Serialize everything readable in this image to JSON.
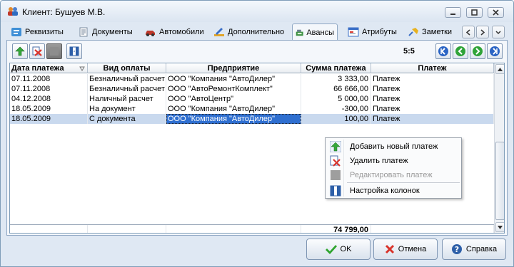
{
  "window": {
    "title": "Клиент: Бушуев М.В."
  },
  "tabs": [
    {
      "label": "Реквизиты",
      "icon": "requisites-icon"
    },
    {
      "label": "Документы",
      "icon": "documents-icon"
    },
    {
      "label": "Автомобили",
      "icon": "car-icon"
    },
    {
      "label": "Дополнительно",
      "icon": "edit-ruler-icon"
    },
    {
      "label": "Авансы",
      "icon": "cash-register-icon",
      "active": true
    },
    {
      "label": "Атрибуты",
      "icon": "attributes-card-icon"
    },
    {
      "label": "Заметки",
      "icon": "notes-pin-icon"
    }
  ],
  "toolbar": {
    "counter": "5:5"
  },
  "grid": {
    "columns": [
      "Дата платежа",
      "Вид оплаты",
      "Предприятие",
      "Сумма платежа",
      "Платеж"
    ],
    "rows": [
      [
        "07.11.2008",
        "Безналичный расчет",
        "ООО \"Компания \"АвтоДилер\"",
        "3 333,00",
        "Платеж"
      ],
      [
        "07.11.2008",
        "Безналичный расчет",
        "ООО \"АвтоРемонтКомплект\"",
        "66 666,00",
        "Платеж"
      ],
      [
        "04.12.2008",
        "Наличный расчет",
        "ООО \"АвтоЦентр\"",
        "5 000,00",
        "Платеж"
      ],
      [
        "18.05.2009",
        "На документ",
        "ООО \"Компания \"АвтоДилер\"",
        "-300,00",
        "Платеж"
      ],
      [
        "18.05.2009",
        "С документа",
        "ООО \"Компания \"АвтоДилер\"",
        "100,00",
        "Платеж"
      ]
    ],
    "selected_row": 4,
    "total": "74 799,00"
  },
  "context_menu": {
    "items": [
      {
        "label": "Добавить новый платеж",
        "icon": "add-arrow-icon",
        "enabled": true
      },
      {
        "label": "Удалить платеж",
        "icon": "delete-icon",
        "enabled": true
      },
      {
        "label": "Редактировать платеж",
        "icon": "edit-icon",
        "enabled": false
      },
      {
        "label": "Настройка колонок",
        "icon": "columns-icon",
        "enabled": true
      }
    ]
  },
  "buttons": {
    "ok": "OK",
    "cancel": "Отмена",
    "help": "Справка"
  },
  "colors": {
    "selection": "#c9d9ee",
    "focus_cell": "#2f6fd0",
    "ok_check": "#2ea52e",
    "cancel_x": "#d9342b"
  }
}
